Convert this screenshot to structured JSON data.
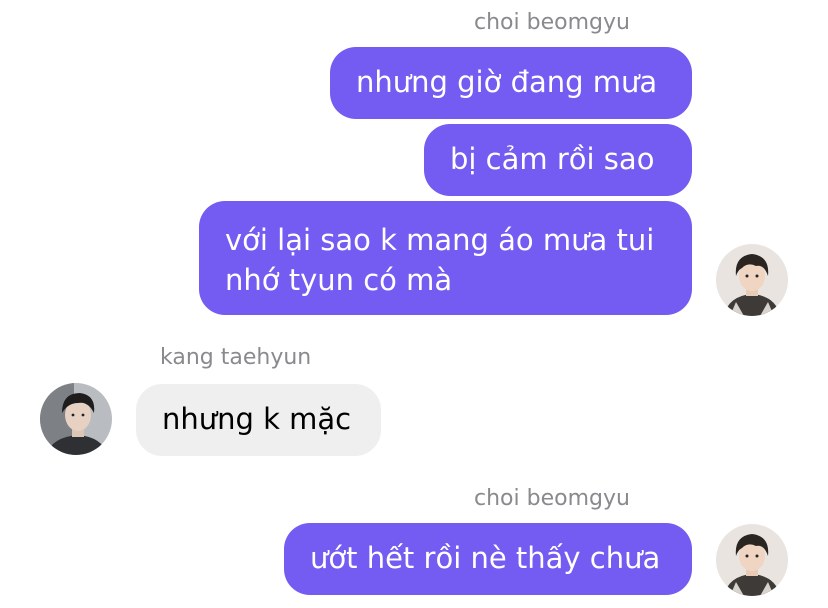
{
  "conversation": {
    "groups": [
      {
        "sender": "choi beomgyu",
        "messages": [
          "nhưng giờ đang mưa",
          "bị cảm rồi sao",
          "với lại sao k mang áo mưa tui nhớ tyun có mà"
        ],
        "avatar": "beomgyu-avatar"
      },
      {
        "sender": "kang taehyun",
        "messages": [
          "nhưng k mặc"
        ],
        "avatar": "taehyun-avatar"
      },
      {
        "sender": "choi beomgyu",
        "messages": [
          "ướt hết rồi nè thấy chưa"
        ],
        "avatar": "beomgyu-avatar"
      }
    ]
  },
  "colors": {
    "outgoing_bubble": "#745bf1",
    "incoming_bubble": "#efeff0",
    "sender_name": "#8a8a8e"
  }
}
